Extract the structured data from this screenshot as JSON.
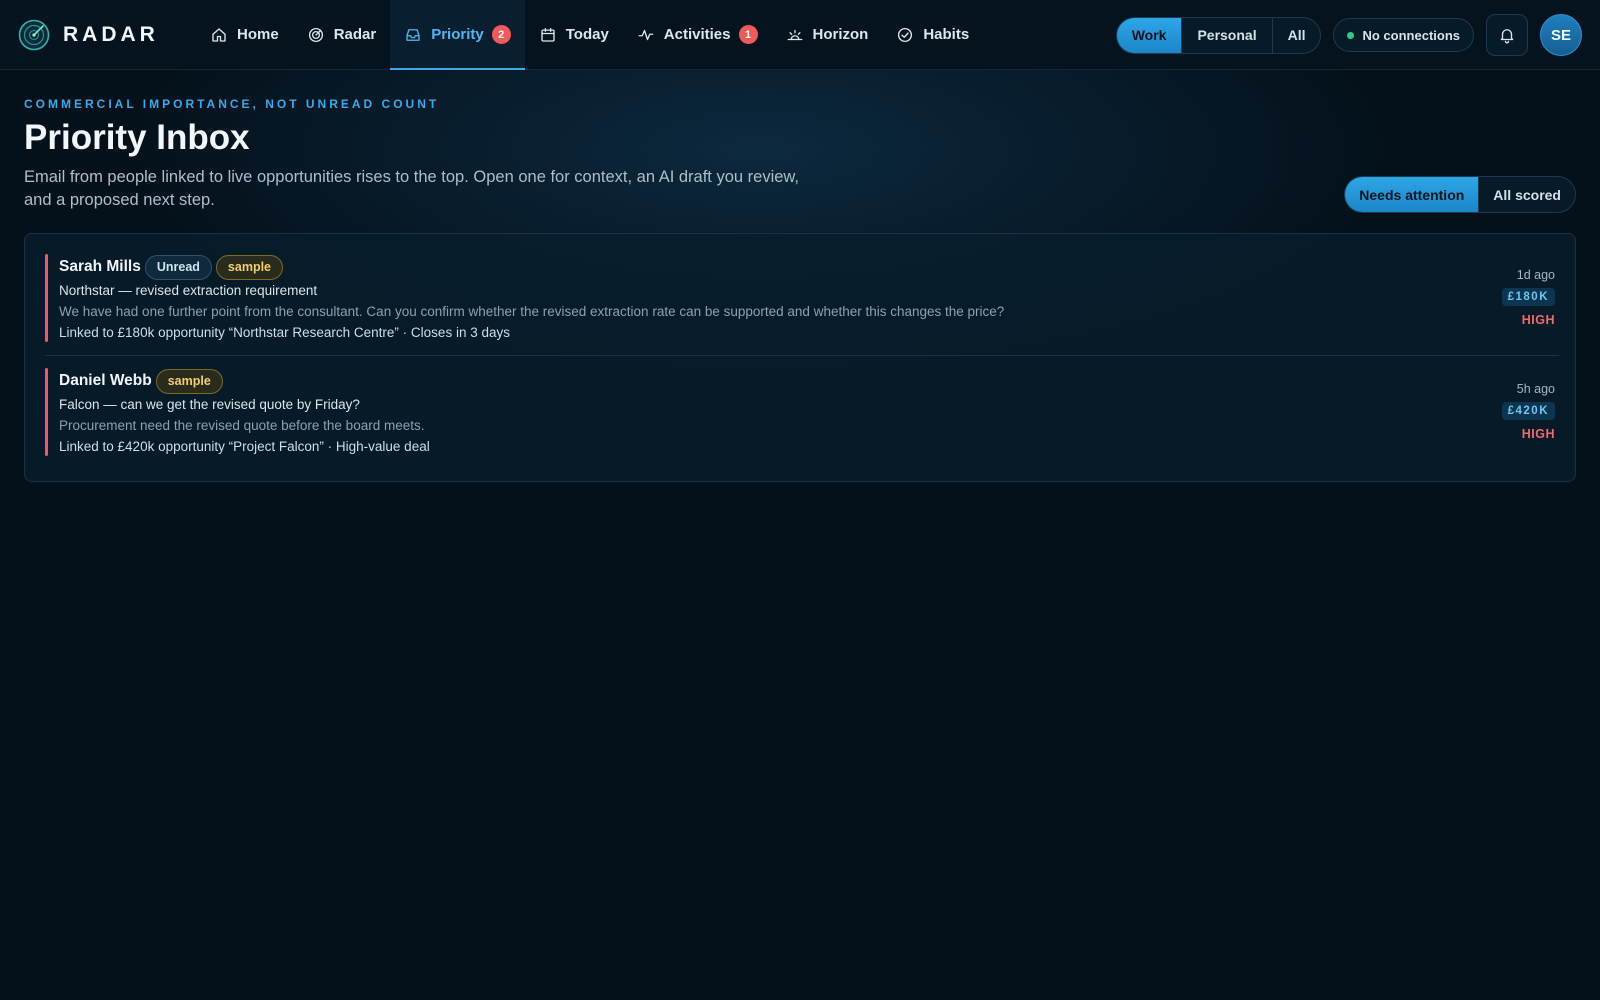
{
  "brand": {
    "name": "RADAR"
  },
  "nav": {
    "items": [
      {
        "label": "Home",
        "icon": "home-icon"
      },
      {
        "label": "Radar",
        "icon": "radar-icon"
      },
      {
        "label": "Priority",
        "icon": "inbox-icon",
        "badge": "2",
        "active": true
      },
      {
        "label": "Today",
        "icon": "calendar-icon"
      },
      {
        "label": "Activities",
        "icon": "activity-icon",
        "badge": "1"
      },
      {
        "label": "Horizon",
        "icon": "horizon-icon"
      },
      {
        "label": "Habits",
        "icon": "check-circle-icon"
      }
    ]
  },
  "context_switch": {
    "options": [
      "Work",
      "Personal",
      "All"
    ],
    "selected": "Work"
  },
  "connections": {
    "status": "No connections"
  },
  "user": {
    "initials": "SE"
  },
  "header": {
    "eyebrow": "COMMERCIAL IMPORTANCE, NOT UNREAD COUNT",
    "title": "Priority Inbox",
    "description": "Email from people linked to live opportunities rises to the top. Open one for context, an AI draft you review, and a proposed next step."
  },
  "filter": {
    "options": [
      "Needs attention",
      "All scored"
    ],
    "selected": "Needs attention"
  },
  "emails": [
    {
      "sender": "Sarah Mills",
      "tags": [
        "Unread",
        "sample"
      ],
      "subject": "Northstar — revised extraction requirement",
      "preview": "We have had one further point from the consultant. Can you confirm whether the revised extraction rate can be supported and whether this changes the price?",
      "link": "Linked to £180k opportunity “Northstar Research Centre” · Closes in 3 days",
      "time": "1d ago",
      "amount": "£180K",
      "priority": "HIGH"
    },
    {
      "sender": "Daniel Webb",
      "tags": [
        "sample"
      ],
      "subject": "Falcon — can we get the revised quote by Friday?",
      "preview": "Procurement need the revised quote before the board meets.",
      "link": "Linked to £420k opportunity “Project Falcon” · High-value deal",
      "time": "5h ago",
      "amount": "£420K",
      "priority": "HIGH"
    }
  ],
  "colors": {
    "accent": "#3aa8e6",
    "priority_high": "#f05a5a",
    "badge": "#f05a5a",
    "connection_dot": "#2fcf80",
    "sample_tag": "#f1d06a"
  }
}
